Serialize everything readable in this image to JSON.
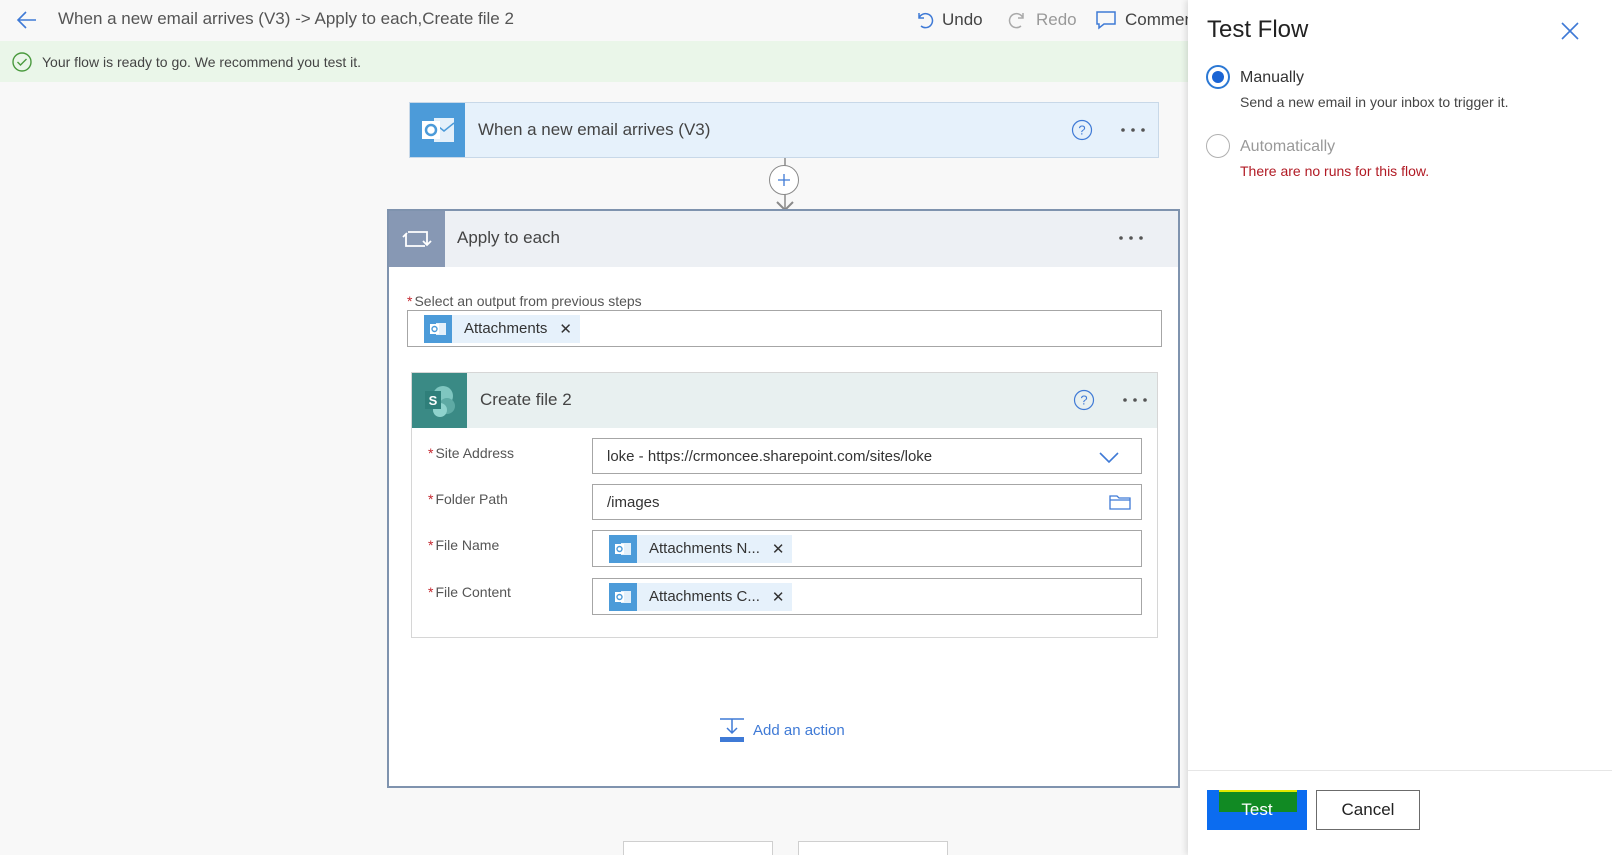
{
  "header": {
    "title": "When a new email arrives (V3) -> Apply to each,Create file 2",
    "undo_label": "Undo",
    "redo_label": "Redo",
    "comments_label": "Commen"
  },
  "banner": {
    "message": "Your flow is ready to go. We recommend you test it."
  },
  "trigger": {
    "title": "When a new email arrives (V3)",
    "icon": "outlook-icon"
  },
  "apply_to_each": {
    "title": "Apply to each",
    "select_label": "Select an output from previous steps",
    "token_label": "Attachments",
    "add_action_label": "Add an action"
  },
  "create_file": {
    "title": "Create file 2",
    "icon": "sharepoint-icon",
    "fields": {
      "site_address_label": "Site Address",
      "site_address_value": "loke - https://crmoncee.sharepoint.com/sites/loke",
      "folder_path_label": "Folder Path",
      "folder_path_value": "/images",
      "file_name_label": "File Name",
      "file_name_token": "Attachments N...",
      "file_content_label": "File Content",
      "file_content_token": "Attachments C..."
    }
  },
  "panel": {
    "title": "Test Flow",
    "manual_label": "Manually",
    "manual_desc": "Send a new email in your inbox to trigger it.",
    "auto_label": "Automatically",
    "auto_error": "There are no runs for this flow.",
    "test_button": "Test",
    "cancel_button": "Cancel",
    "selected_option": "Manually"
  },
  "colors": {
    "accent": "#0b6cf0",
    "error": "#b11a24",
    "banner_bg": "#eaf6e9"
  }
}
